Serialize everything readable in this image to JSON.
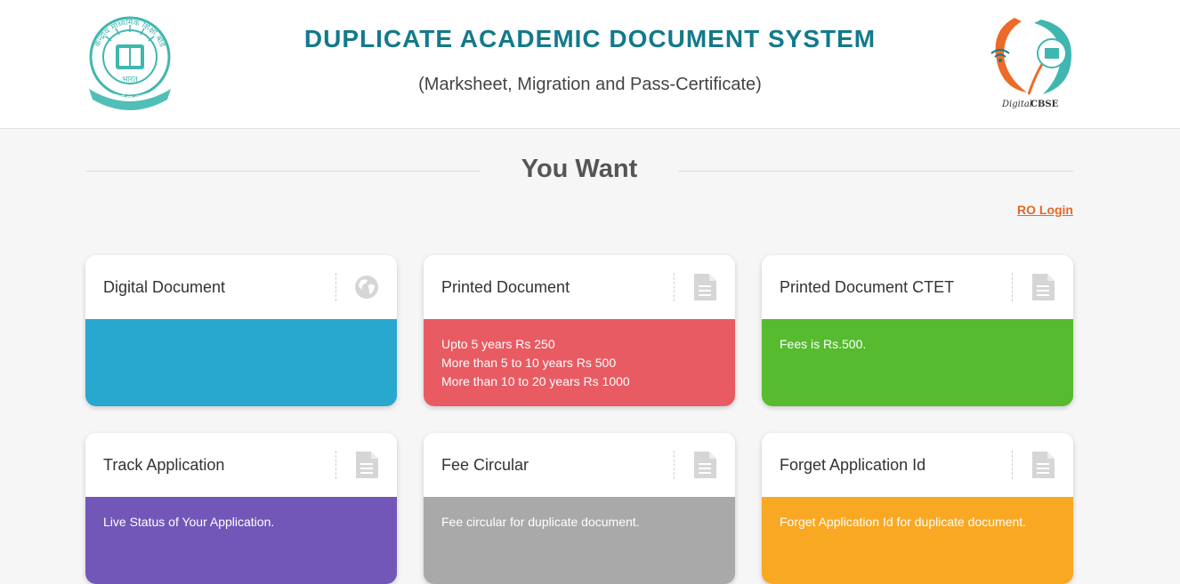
{
  "header": {
    "title": "DUPLICATE ACADEMIC DOCUMENT SYSTEM",
    "subtitle": "(Marksheet, Migration and Pass-Certificate)",
    "logo_left_top_text": "केन्द्रीय माध्यमिक शिक्षा बोर्ड",
    "logo_left_bottom_text": "भारत",
    "logo_left_motto": "असतो मा सद्गमय",
    "logo_right_text_italic": "Digital",
    "logo_right_text_bold": "CBSE"
  },
  "section": {
    "title": "You Want"
  },
  "links": {
    "ro_login": "RO Login"
  },
  "cards": [
    {
      "title": "Digital Document",
      "icon": "globe-icon",
      "color": "#28a7cf",
      "lines": []
    },
    {
      "title": "Printed Document",
      "icon": "document-icon",
      "color": "#e85b63",
      "lines": [
        "Upto 5 years Rs 250",
        "More than 5 to 10 years Rs 500",
        "More than 10 to 20 years Rs 1000"
      ]
    },
    {
      "title": "Printed Document CTET",
      "icon": "document-icon",
      "color": "#56bb2f",
      "lines": [
        "Fees is Rs.500."
      ]
    },
    {
      "title": "Track Application",
      "icon": "document-icon",
      "color": "#7257b9",
      "lines": [
        "Live Status of Your Application."
      ]
    },
    {
      "title": "Fee Circular",
      "icon": "document-icon",
      "color": "#a9a9a9",
      "lines": [
        "Fee circular for duplicate document."
      ]
    },
    {
      "title": "Forget Application Id",
      "icon": "document-icon",
      "color": "#f8a823",
      "lines": [
        "Forget Application Id for duplicate document."
      ]
    }
  ],
  "colors": {
    "title_teal": "#137a8a",
    "link_orange": "#e06a2b",
    "logo_teal": "#3fb7b0",
    "logo_orange": "#ec6b28"
  }
}
